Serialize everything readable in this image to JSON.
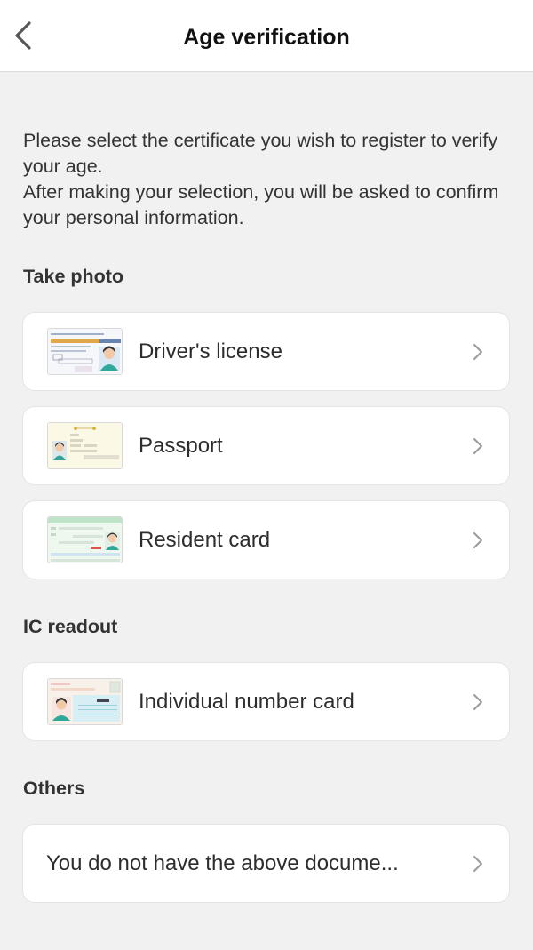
{
  "header": {
    "title": "Age verification",
    "back_icon": "chevron-left-icon"
  },
  "intro": {
    "line1": "Please select the certificate you wish to register to verify your age.",
    "line2": "After making your selection, you will be asked to confirm your personal information."
  },
  "sections": {
    "take_photo": {
      "heading": "Take photo",
      "items": [
        {
          "label": "Driver's license",
          "icon": "drivers-license-card-icon"
        },
        {
          "label": "Passport",
          "icon": "passport-icon"
        },
        {
          "label": "Resident card",
          "icon": "resident-card-icon"
        }
      ]
    },
    "ic_readout": {
      "heading": "IC readout",
      "items": [
        {
          "label": "Individual number card",
          "icon": "individual-number-card-icon"
        }
      ]
    },
    "others": {
      "heading": "Others",
      "items": [
        {
          "label": "You do not have the above docume..."
        }
      ]
    }
  },
  "colors": {
    "background": "#f1f1f1",
    "card": "#ffffff",
    "text": "#2a2a2a",
    "chevron": "#9a9a9a"
  }
}
